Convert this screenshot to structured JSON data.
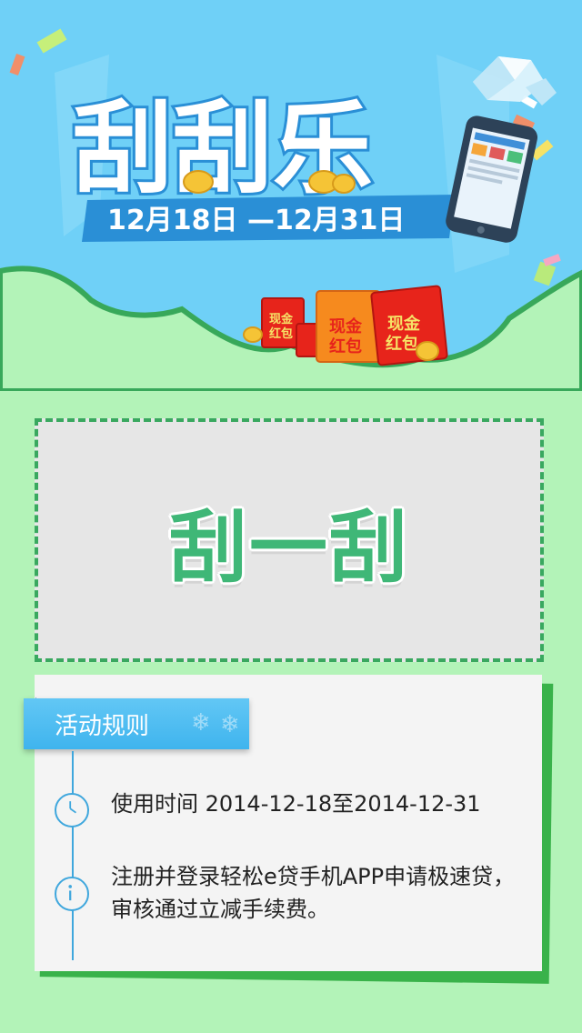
{
  "banner": {
    "title": "刮刮乐",
    "date_range": "12月18日 —12月31日",
    "red_packet_text": "现金红包",
    "colors": {
      "sky": "#6fd0f7",
      "hill": "#b3f3b8",
      "hill_outline": "#38a85a",
      "date_bar": "#2a8fd6"
    }
  },
  "scratch": {
    "label": "刮一刮"
  },
  "rules": {
    "title": "活动规则",
    "items": [
      {
        "icon": "clock-icon",
        "text": "使用时间 2014-12-18至2014-12-31"
      },
      {
        "icon": "info-icon",
        "text": "注册并登录轻松e贷手机APP申请极速贷，审核通过立减手续费。"
      }
    ]
  }
}
